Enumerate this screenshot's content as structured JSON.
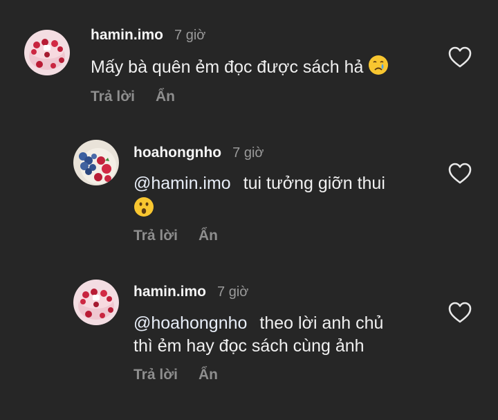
{
  "comments": [
    {
      "username": "hamin.imo",
      "time": "7 giờ",
      "mention": "",
      "text": "Mấy bà quên ẻm đọc được sách hả",
      "emoji": "crying-face",
      "reply_label": "Trả lời",
      "hide_label": "Ẩn",
      "avatar": "cake-with-strawberries"
    },
    {
      "username": "hoahongnho",
      "time": "7 giờ",
      "mention": "@hamin.imo",
      "text": "tui tưởng giỡn thui",
      "emoji": "surprised-face",
      "reply_label": "Trả lời",
      "hide_label": "Ẩn",
      "avatar": "bowl-of-berries"
    },
    {
      "username": "hamin.imo",
      "time": "7 giờ",
      "mention": "@hoahongnho",
      "text_line1": "theo lời anh chủ",
      "text_line2": "thì ẻm hay đọc sách cùng ảnh",
      "reply_label": "Trả lời",
      "hide_label": "Ẩn",
      "avatar": "cake-with-strawberries"
    }
  ],
  "colors": {
    "background": "#262626",
    "secondary_text": "#8e8e8e",
    "primary_text": "#f5f5f5"
  }
}
